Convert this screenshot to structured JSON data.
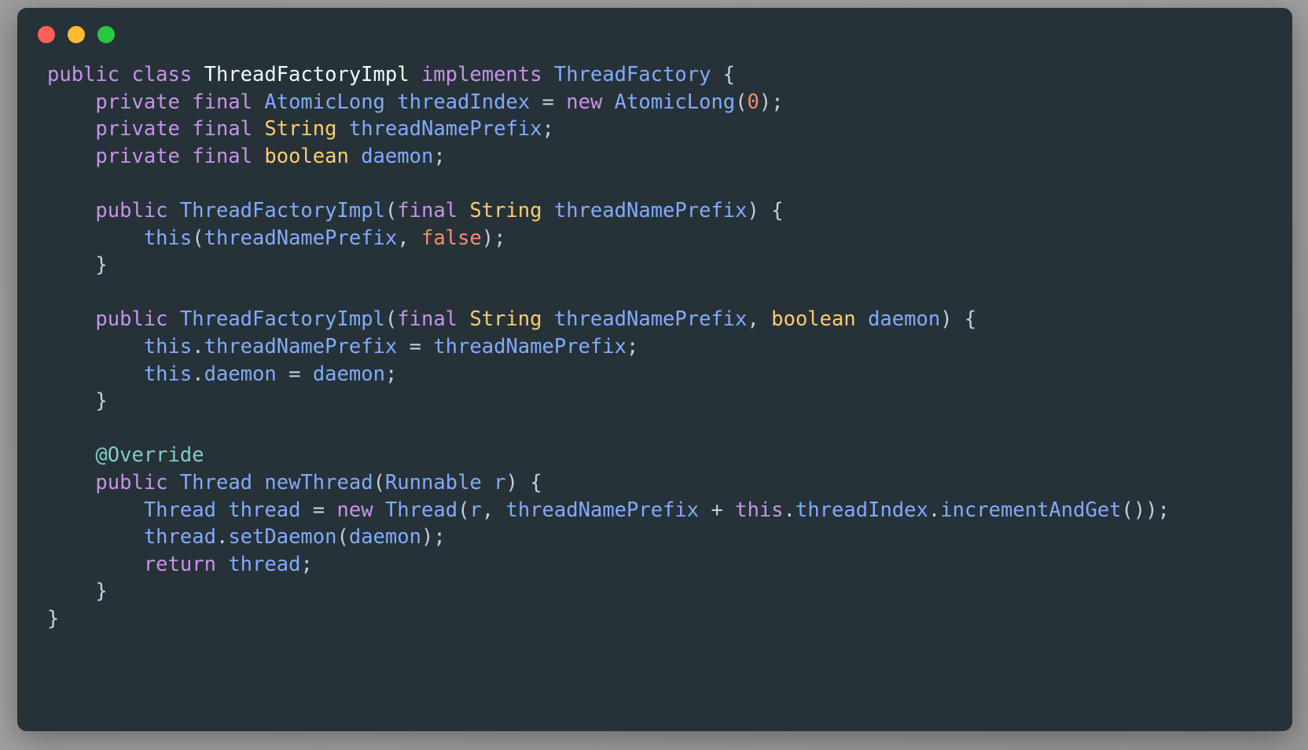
{
  "window": {
    "title": "",
    "controls": [
      {
        "name": "close",
        "color": "#ff5f57"
      },
      {
        "name": "minimize",
        "color": "#febc2e"
      },
      {
        "name": "maximize",
        "color": "#28c840"
      }
    ],
    "background": "#263238"
  },
  "theme": {
    "name": "Material Palenight",
    "background": "#263238",
    "foreground": "#c3cee3",
    "keyword": "#c792ea",
    "type": "#82aaff",
    "builtin_type": "#ffcb6b",
    "literal": "#f78c6c",
    "annotation": "#80cbc4",
    "punctuation": "#89ddff",
    "class_name": "#eeffff"
  },
  "code": {
    "language": "Java",
    "class_name": "ThreadFactoryImpl",
    "lines": [
      "public class ThreadFactoryImpl implements ThreadFactory {",
      "    private final AtomicLong threadIndex = new AtomicLong(0);",
      "    private final String threadNamePrefix;",
      "    private final boolean daemon;",
      "",
      "    public ThreadFactoryImpl(final String threadNamePrefix) {",
      "        this(threadNamePrefix, false);",
      "    }",
      "",
      "    public ThreadFactoryImpl(final String threadNamePrefix, boolean daemon) {",
      "        this.threadNamePrefix = threadNamePrefix;",
      "        this.daemon = daemon;",
      "    }",
      "",
      "    @Override",
      "    public Thread newThread(Runnable r) {",
      "        Thread thread = new Thread(r, threadNamePrefix + this.threadIndex.incrementAndGet());",
      "        thread.setDaemon(daemon);",
      "        return thread;",
      "    }",
      "}"
    ],
    "tokens": [
      [
        [
          "public ",
          "kw"
        ],
        [
          "class ",
          "kw"
        ],
        [
          "ThreadFactoryImpl",
          "wht"
        ],
        [
          " ",
          "pla"
        ],
        [
          "implements",
          "kw"
        ],
        [
          " ",
          "pla"
        ],
        [
          "ThreadFactory",
          "typ"
        ],
        [
          " ",
          "pla"
        ],
        [
          "{",
          "pla"
        ]
      ],
      [
        [
          "    ",
          "pla"
        ],
        [
          "private",
          "kw"
        ],
        [
          " ",
          "pla"
        ],
        [
          "final",
          "kw"
        ],
        [
          " ",
          "pla"
        ],
        [
          "AtomicLong",
          "typ"
        ],
        [
          " ",
          "pla"
        ],
        [
          "threadIndex",
          "typ"
        ],
        [
          " ",
          "pla"
        ],
        [
          "=",
          "pla"
        ],
        [
          " ",
          "pla"
        ],
        [
          "new",
          "kw"
        ],
        [
          " ",
          "pla"
        ],
        [
          "AtomicLong",
          "typ"
        ],
        [
          "(",
          "pla"
        ],
        [
          "0",
          "num"
        ],
        [
          ")",
          "pla"
        ],
        [
          ";",
          "pla"
        ]
      ],
      [
        [
          "    ",
          "pla"
        ],
        [
          "private",
          "kw"
        ],
        [
          " ",
          "pla"
        ],
        [
          "final",
          "kw"
        ],
        [
          " ",
          "pla"
        ],
        [
          "String",
          "yel"
        ],
        [
          " ",
          "pla"
        ],
        [
          "threadNamePrefix",
          "typ"
        ],
        [
          ";",
          "pla"
        ]
      ],
      [
        [
          "    ",
          "pla"
        ],
        [
          "private",
          "kw"
        ],
        [
          " ",
          "pla"
        ],
        [
          "final",
          "kw"
        ],
        [
          " ",
          "pla"
        ],
        [
          "boolean",
          "yel"
        ],
        [
          " ",
          "pla"
        ],
        [
          "daemon",
          "typ"
        ],
        [
          ";",
          "pla"
        ]
      ],
      [],
      [
        [
          "    ",
          "pla"
        ],
        [
          "public",
          "kw"
        ],
        [
          " ",
          "pla"
        ],
        [
          "ThreadFactoryImpl",
          "typ"
        ],
        [
          "(",
          "pla"
        ],
        [
          "final",
          "kw"
        ],
        [
          " ",
          "pla"
        ],
        [
          "String",
          "yel"
        ],
        [
          " ",
          "pla"
        ],
        [
          "threadNamePrefix",
          "typ"
        ],
        [
          ")",
          "pla"
        ],
        [
          " ",
          "pla"
        ],
        [
          "{",
          "pla"
        ]
      ],
      [
        [
          "        ",
          "pla"
        ],
        [
          "this",
          "typ"
        ],
        [
          "(",
          "pla"
        ],
        [
          "threadNamePrefix",
          "typ"
        ],
        [
          ", ",
          "pla"
        ],
        [
          "false",
          "num"
        ],
        [
          ")",
          "pla"
        ],
        [
          ";",
          "pla"
        ]
      ],
      [
        [
          "    ",
          "pla"
        ],
        [
          "}",
          "pla"
        ]
      ],
      [],
      [
        [
          "    ",
          "pla"
        ],
        [
          "public",
          "kw"
        ],
        [
          " ",
          "pla"
        ],
        [
          "ThreadFactoryImpl",
          "typ"
        ],
        [
          "(",
          "pla"
        ],
        [
          "final",
          "kw"
        ],
        [
          " ",
          "pla"
        ],
        [
          "String",
          "yel"
        ],
        [
          " ",
          "pla"
        ],
        [
          "threadNamePrefix",
          "typ"
        ],
        [
          ", ",
          "pla"
        ],
        [
          "boolean",
          "yel"
        ],
        [
          " ",
          "pla"
        ],
        [
          "daemon",
          "typ"
        ],
        [
          ")",
          "pla"
        ],
        [
          " ",
          "pla"
        ],
        [
          "{",
          "pla"
        ]
      ],
      [
        [
          "        ",
          "pla"
        ],
        [
          "this",
          "typ"
        ],
        [
          ".",
          "pla"
        ],
        [
          "threadNamePrefix",
          "typ"
        ],
        [
          " ",
          "pla"
        ],
        [
          "=",
          "pla"
        ],
        [
          " ",
          "pla"
        ],
        [
          "threadNamePrefix",
          "typ"
        ],
        [
          ";",
          "pla"
        ]
      ],
      [
        [
          "        ",
          "pla"
        ],
        [
          "this",
          "typ"
        ],
        [
          ".",
          "pla"
        ],
        [
          "daemon",
          "typ"
        ],
        [
          " ",
          "pla"
        ],
        [
          "=",
          "pla"
        ],
        [
          " ",
          "pla"
        ],
        [
          "daemon",
          "typ"
        ],
        [
          ";",
          "pla"
        ]
      ],
      [
        [
          "    ",
          "pla"
        ],
        [
          "}",
          "pla"
        ]
      ],
      [],
      [
        [
          "    ",
          "pla"
        ],
        [
          "@Override",
          "ann"
        ]
      ],
      [
        [
          "    ",
          "pla"
        ],
        [
          "public",
          "kw"
        ],
        [
          " ",
          "pla"
        ],
        [
          "Thread",
          "typ"
        ],
        [
          " ",
          "pla"
        ],
        [
          "newThread",
          "typ"
        ],
        [
          "(",
          "pla"
        ],
        [
          "Runnable",
          "typ"
        ],
        [
          " ",
          "pla"
        ],
        [
          "r",
          "typ"
        ],
        [
          ")",
          "pla"
        ],
        [
          " ",
          "pla"
        ],
        [
          "{",
          "pla"
        ]
      ],
      [
        [
          "        ",
          "pla"
        ],
        [
          "Thread",
          "typ"
        ],
        [
          " ",
          "pla"
        ],
        [
          "thread",
          "typ"
        ],
        [
          " ",
          "pla"
        ],
        [
          "=",
          "pla"
        ],
        [
          " ",
          "pla"
        ],
        [
          "new",
          "kw"
        ],
        [
          " ",
          "pla"
        ],
        [
          "Thread",
          "typ"
        ],
        [
          "(",
          "pla"
        ],
        [
          "r",
          "typ"
        ],
        [
          ", ",
          "pla"
        ],
        [
          "threadNamePrefix",
          "typ"
        ],
        [
          " ",
          "pla"
        ],
        [
          "+",
          "pla"
        ],
        [
          " ",
          "pla"
        ],
        [
          "this",
          "kw"
        ],
        [
          ".",
          "pla"
        ],
        [
          "threadIndex",
          "typ"
        ],
        [
          ".",
          "pla"
        ],
        [
          "incrementAndGet",
          "typ"
        ],
        [
          "(",
          "pla"
        ],
        [
          ")",
          "pla"
        ],
        [
          ")",
          "pla"
        ],
        [
          ";",
          "pla"
        ]
      ],
      [
        [
          "        ",
          "pla"
        ],
        [
          "thread",
          "typ"
        ],
        [
          ".",
          "pla"
        ],
        [
          "setDaemon",
          "typ"
        ],
        [
          "(",
          "pla"
        ],
        [
          "daemon",
          "typ"
        ],
        [
          ")",
          "pla"
        ],
        [
          ";",
          "pla"
        ]
      ],
      [
        [
          "        ",
          "pla"
        ],
        [
          "return",
          "kw"
        ],
        [
          " ",
          "pla"
        ],
        [
          "thread",
          "typ"
        ],
        [
          ";",
          "pla"
        ]
      ],
      [
        [
          "    ",
          "pla"
        ],
        [
          "}",
          "pla"
        ]
      ],
      [
        [
          "}",
          "pla"
        ]
      ]
    ]
  }
}
